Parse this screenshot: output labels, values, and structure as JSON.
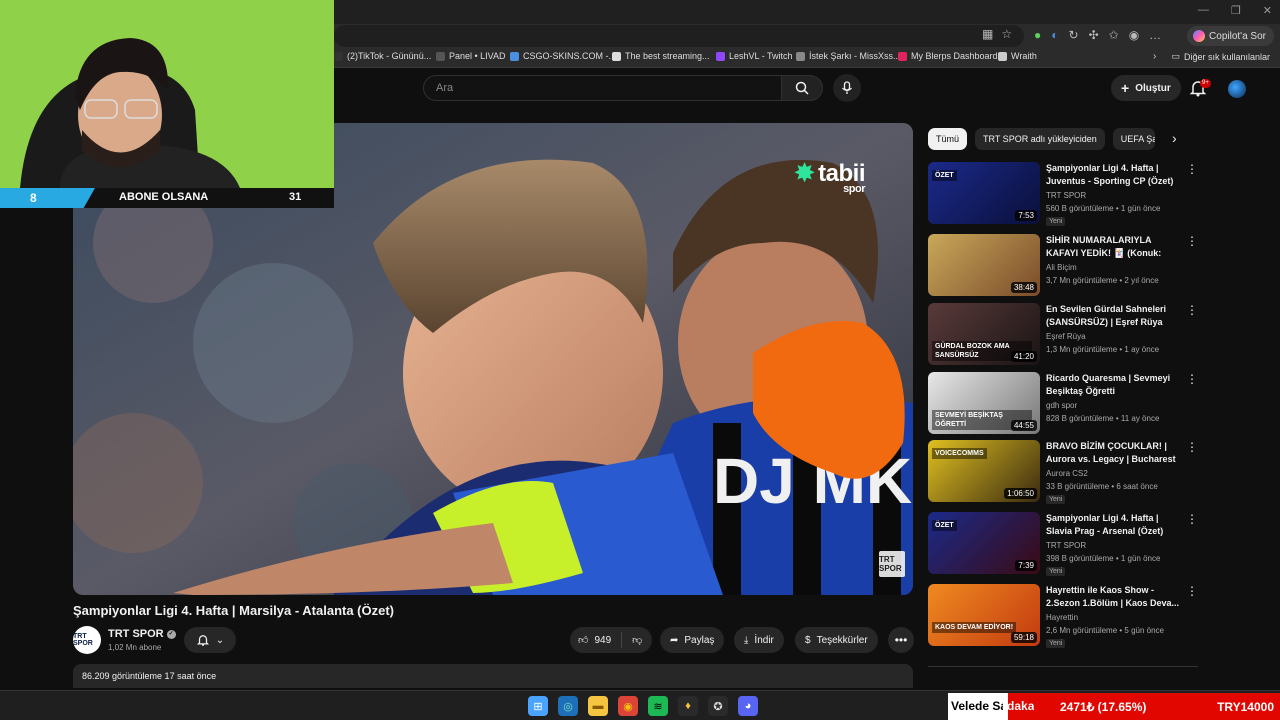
{
  "browser": {
    "copilot_label": "Copilot'a Sor",
    "other_bookmarks": "Diğer sık kullanılanlar",
    "bookmarks": [
      {
        "label": "(2)TikTok - Gününü...",
        "color": "#333333"
      },
      {
        "label": "Panel • LIVAD",
        "color": "#555555"
      },
      {
        "label": "CSGO-SKINS.COM -...",
        "color": "#4a90e2"
      },
      {
        "label": "The best streaming...",
        "color": "#dddddd"
      },
      {
        "label": "LeshVL - Twitch",
        "color": "#9146ff"
      },
      {
        "label": "İstek Şarkı - MissXss...",
        "color": "#888888"
      },
      {
        "label": "My Blerps Dashboard",
        "color": "#e0245e"
      },
      {
        "label": "Wraith",
        "color": "#cccccc"
      }
    ]
  },
  "youtube": {
    "search_placeholder": "Ara",
    "create_label": "Oluştur",
    "notif_badge": "9+"
  },
  "video": {
    "title": "Şampiyonlar Ligi 4. Hafta | Marsilya - Atalanta (Özet)",
    "brand": "tabii",
    "brand_sub": "spor",
    "watermark": "TRT SPOR",
    "jersey_text": "DJ MKH",
    "channel_name": "TRT SPOR",
    "channel_avatar_text": "TRT SPOR",
    "subscribers": "1,02 Mn abone",
    "likes": "949",
    "share_label": "Paylaş",
    "download_label": "İndir",
    "thanks_label": "Teşekkürler",
    "more_label": "•••",
    "views_line": "86.209 görüntüleme  17 saat önce"
  },
  "chips": [
    "Tümü",
    "TRT SPOR adlı yükleyiciden",
    "UEFA Şan"
  ],
  "recommendations": [
    {
      "title": "Şampiyonlar Ligi 4. Hafta | Juventus - Sporting CP (Özet)",
      "channel": "TRT SPOR",
      "meta": "560 B görüntüleme • 1 gün önce",
      "duration": "7:53",
      "new": "Yeni",
      "thumb_overlay": "ÖZET",
      "c1": "#1b2a8a",
      "c2": "#0a0f3a"
    },
    {
      "title": "SİHİR NUMARALARIYLA KAFAYI YEDİK! 🃏 (Konuk: BigMagic ...",
      "channel": "Ali Biçim",
      "meta": "3,7 Mn görüntüleme • 2 yıl önce",
      "duration": "38:48",
      "new": "",
      "thumb_overlay": "",
      "c1": "#c9a85a",
      "c2": "#7a4b2a"
    },
    {
      "title": "En Sevilen Gürdal Sahneleri (SANSÜRSÜZ) | Eşref Rüya",
      "channel": "Eşref Rüya",
      "meta": "1,3 Mn görüntüleme • 1 ay önce",
      "duration": "41:20",
      "new": "",
      "thumb_overlay": "GÜRDAL BOZOK AMA SANSÜRSÜZ",
      "c1": "#5a3a3a",
      "c2": "#1a1414"
    },
    {
      "title": "Ricardo Quaresma | Sevmeyi Beşiktaş Öğretti",
      "channel": "gdh spor",
      "meta": "828 B görüntüleme • 11 ay önce",
      "duration": "44:55",
      "new": "",
      "thumb_overlay": "SEVMEYİ BEŞİKTAŞ ÖĞRETTİ",
      "c1": "#e8e8e8",
      "c2": "#777777"
    },
    {
      "title": "BRAVO BİZİM ÇOCUKLAR! | Aurora vs. Legacy | Bucharest ...",
      "channel": "Aurora CS2",
      "meta": "33 B görüntüleme • 6 saat önce",
      "duration": "1:06:50",
      "new": "Yeni",
      "thumb_overlay": "VOICECOMMS",
      "c1": "#e0c020",
      "c2": "#3a2a10"
    },
    {
      "title": "Şampiyonlar Ligi 4. Hafta | Slavia Prag - Arsenal (Özet)",
      "channel": "TRT SPOR",
      "meta": "398 B görüntüleme • 1 gün önce",
      "duration": "7:39",
      "new": "Yeni",
      "thumb_overlay": "ÖZET",
      "c1": "#1b2a8a",
      "c2": "#3a0a12"
    },
    {
      "title": "Hayrettin ile Kaos Show - 2.Sezon 1.Bölüm | Kaos Deva...",
      "channel": "Hayrettin",
      "meta": "2,6 Mn görüntüleme • 5 gün önce",
      "duration": "59:18",
      "new": "Yeni",
      "thumb_overlay": "KAOS DEVAM EDİYOR!",
      "c1": "#f08a20",
      "c2": "#c23a10"
    }
  ],
  "webcam": {
    "left_number": "8",
    "label": "ABONE OLSANA",
    "right_number": "31",
    "bg_color": "#8fd24a"
  },
  "donation": {
    "name": "Velede Sadaka",
    "amount": "2471₺ (17.65%)",
    "goal": "TRY14000"
  },
  "taskbar_icons": [
    "windows-logo",
    "edge",
    "file-explorer",
    "chrome",
    "spotify",
    "app-lamp",
    "app-github",
    "discord"
  ]
}
